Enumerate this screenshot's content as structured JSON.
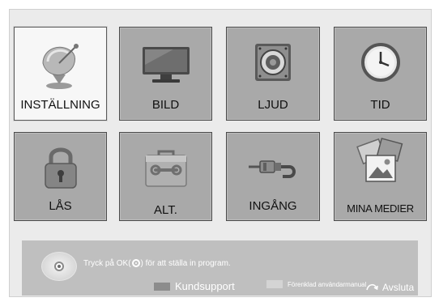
{
  "menu": {
    "tiles": [
      {
        "label": "INSTÄLLNING",
        "icon": "satellite-dish-icon"
      },
      {
        "label": "BILD",
        "icon": "tv-monitor-icon"
      },
      {
        "label": "LJUD",
        "icon": "speaker-icon"
      },
      {
        "label": "TID",
        "icon": "clock-icon"
      },
      {
        "label": "LÅS",
        "icon": "padlock-icon"
      },
      {
        "label": "ALT.",
        "icon": "toolbox-icon"
      },
      {
        "label": "INGÅNG",
        "icon": "cable-plug-icon"
      },
      {
        "label": "MINA MEDIER",
        "icon": "media-photos-icon"
      }
    ],
    "selected": "INSTÄLLNING"
  },
  "help": {
    "instruction_prefix": "Tryck på OK(",
    "instruction_suffix": ") för att ställa in program.",
    "support_label": "Kundsupport",
    "manual_label": "Förenklad användarmanual",
    "exit_label": "Avsluta"
  },
  "colors": {
    "tile_bg": "#a9a9a9",
    "tile_selected_bg": "#f7f7f7",
    "help_bar_bg": "#bfbfbf",
    "support_swatch": "#8c8c8c",
    "manual_swatch": "#d4d4d4"
  }
}
